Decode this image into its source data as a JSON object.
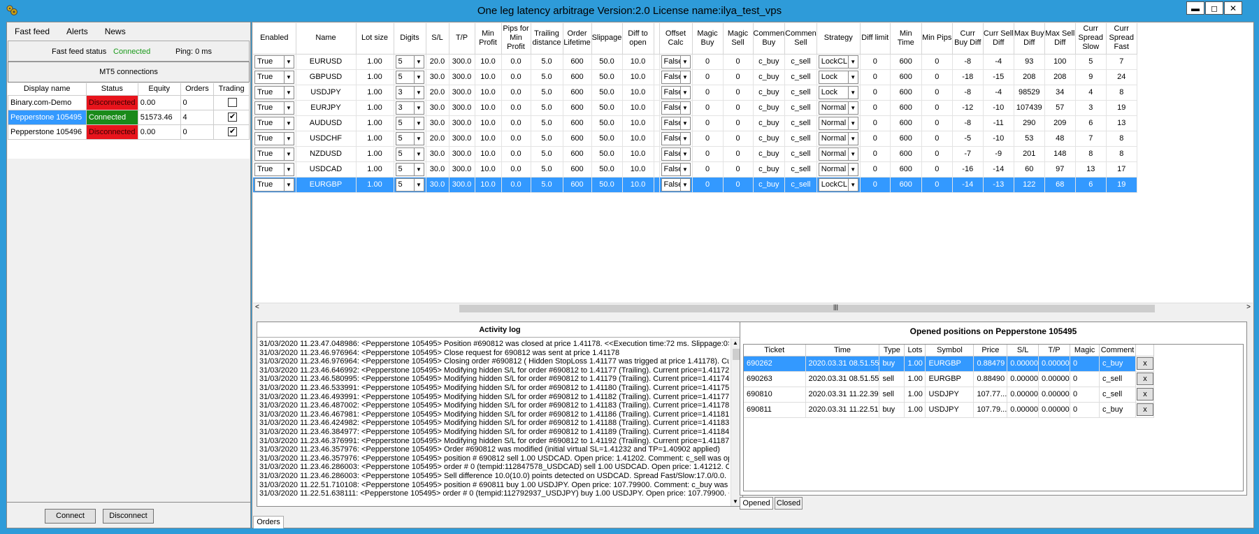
{
  "window": {
    "title": "One leg latency arbitrage Version:2.0 License name:ilya_test_vps",
    "minimize": "▬",
    "maximize": "◻",
    "close": "✕",
    "app_icon": "gear-cluster-icon"
  },
  "menu": {
    "items": [
      "Fast feed",
      "Alerts",
      "News"
    ]
  },
  "feed": {
    "status_label": "Fast feed status",
    "status_value": "Connected",
    "status_color": "#1a9a1a",
    "ping": "Ping: 0 ms"
  },
  "mt5_button": "MT5 connections",
  "accounts": {
    "headers": [
      "Display name",
      "Status",
      "Equity",
      "Orders",
      "Trading"
    ],
    "rows": [
      {
        "name": "Binary.com-Demo",
        "status": "Disconnected",
        "status_color": "#e8141c",
        "equity": "0.00",
        "orders": "0",
        "trading": false,
        "selected": false
      },
      {
        "name": "Pepperstone 105495",
        "status": "Connected",
        "status_color": "#1a8a1a",
        "equity": "51573.46",
        "orders": "4",
        "trading": true,
        "selected": true
      },
      {
        "name": "Pepperstone 105496",
        "status": "Disconnected",
        "status_color": "#e8141c",
        "equity": "0.00",
        "orders": "0",
        "trading": true,
        "selected": false
      }
    ]
  },
  "left_buttons": {
    "connect": "Connect",
    "disconnect": "Disconnect"
  },
  "grid": {
    "headers": [
      "Enabled",
      "Name",
      "Lot size",
      "Digits",
      "S/L",
      "T/P",
      "Min Profit",
      "Pips for Min Profit",
      "Trailing distance",
      "Order Lifetime",
      "Slippage",
      "Diff to open",
      "",
      "Offset Calc",
      "Magic Buy",
      "Magic Sell",
      "Commen Buy",
      "Commen Sell",
      "Strategy",
      "Diff limit",
      "Min Time",
      "Min Pips",
      "Curr Buy Diff",
      "Curr Sell Diff",
      "Max Buy Diff",
      "Max Sell Diff",
      "Curr Spread Slow",
      "Curr Spread Fast"
    ],
    "rows": [
      {
        "enabled": "True",
        "name": "EURUSD",
        "lot": "1.00",
        "digits": "5",
        "sl": "20.0",
        "tp": "300.0",
        "minp": "10.0",
        "pips": "0.0",
        "trail": "5.0",
        "life": "600",
        "slip": "50.0",
        "diff": "10.0",
        "offset": "False",
        "mbuy": "0",
        "msell": "0",
        "cbuy": "c_buy",
        "csell": "c_sell",
        "strategy": "LockCL",
        "dlimit": "0",
        "mintime": "600",
        "minpips": "0",
        "cbd": "-8",
        "csd": "-4",
        "mbd": "93",
        "msd": "100",
        "css": "5",
        "csf": "7",
        "selected": false
      },
      {
        "enabled": "True",
        "name": "GBPUSD",
        "lot": "1.00",
        "digits": "5",
        "sl": "30.0",
        "tp": "300.0",
        "minp": "10.0",
        "pips": "0.0",
        "trail": "5.0",
        "life": "600",
        "slip": "50.0",
        "diff": "10.0",
        "offset": "False",
        "mbuy": "0",
        "msell": "0",
        "cbuy": "c_buy",
        "csell": "c_sell",
        "strategy": "Lock",
        "dlimit": "0",
        "mintime": "600",
        "minpips": "0",
        "cbd": "-18",
        "csd": "-15",
        "mbd": "208",
        "msd": "208",
        "css": "9",
        "csf": "24",
        "selected": false
      },
      {
        "enabled": "True",
        "name": "USDJPY",
        "lot": "1.00",
        "digits": "3",
        "sl": "20.0",
        "tp": "300.0",
        "minp": "10.0",
        "pips": "0.0",
        "trail": "5.0",
        "life": "600",
        "slip": "50.0",
        "diff": "10.0",
        "offset": "False",
        "mbuy": "0",
        "msell": "0",
        "cbuy": "c_buy",
        "csell": "c_sell",
        "strategy": "Lock",
        "dlimit": "0",
        "mintime": "600",
        "minpips": "0",
        "cbd": "-8",
        "csd": "-4",
        "mbd": "98529",
        "msd": "34",
        "css": "4",
        "csf": "8",
        "selected": false
      },
      {
        "enabled": "True",
        "name": "EURJPY",
        "lot": "1.00",
        "digits": "3",
        "sl": "30.0",
        "tp": "300.0",
        "minp": "10.0",
        "pips": "0.0",
        "trail": "5.0",
        "life": "600",
        "slip": "50.0",
        "diff": "10.0",
        "offset": "False",
        "mbuy": "0",
        "msell": "0",
        "cbuy": "c_buy",
        "csell": "c_sell",
        "strategy": "Normal",
        "dlimit": "0",
        "mintime": "600",
        "minpips": "0",
        "cbd": "-12",
        "csd": "-10",
        "mbd": "107439",
        "msd": "57",
        "css": "3",
        "csf": "19",
        "selected": false
      },
      {
        "enabled": "True",
        "name": "AUDUSD",
        "lot": "1.00",
        "digits": "5",
        "sl": "30.0",
        "tp": "300.0",
        "minp": "10.0",
        "pips": "0.0",
        "trail": "5.0",
        "life": "600",
        "slip": "50.0",
        "diff": "10.0",
        "offset": "False",
        "mbuy": "0",
        "msell": "0",
        "cbuy": "c_buy",
        "csell": "c_sell",
        "strategy": "Normal",
        "dlimit": "0",
        "mintime": "600",
        "minpips": "0",
        "cbd": "-8",
        "csd": "-11",
        "mbd": "290",
        "msd": "209",
        "css": "6",
        "csf": "13",
        "selected": false
      },
      {
        "enabled": "True",
        "name": "USDCHF",
        "lot": "1.00",
        "digits": "5",
        "sl": "20.0",
        "tp": "300.0",
        "minp": "10.0",
        "pips": "0.0",
        "trail": "5.0",
        "life": "600",
        "slip": "50.0",
        "diff": "10.0",
        "offset": "False",
        "mbuy": "0",
        "msell": "0",
        "cbuy": "c_buy",
        "csell": "c_sell",
        "strategy": "Normal",
        "dlimit": "0",
        "mintime": "600",
        "minpips": "0",
        "cbd": "-5",
        "csd": "-10",
        "mbd": "53",
        "msd": "48",
        "css": "7",
        "csf": "8",
        "selected": false
      },
      {
        "enabled": "True",
        "name": "NZDUSD",
        "lot": "1.00",
        "digits": "5",
        "sl": "30.0",
        "tp": "300.0",
        "minp": "10.0",
        "pips": "0.0",
        "trail": "5.0",
        "life": "600",
        "slip": "50.0",
        "diff": "10.0",
        "offset": "False",
        "mbuy": "0",
        "msell": "0",
        "cbuy": "c_buy",
        "csell": "c_sell",
        "strategy": "Normal",
        "dlimit": "0",
        "mintime": "600",
        "minpips": "0",
        "cbd": "-7",
        "csd": "-9",
        "mbd": "201",
        "msd": "148",
        "css": "8",
        "csf": "8",
        "selected": false
      },
      {
        "enabled": "True",
        "name": "USDCAD",
        "lot": "1.00",
        "digits": "5",
        "sl": "30.0",
        "tp": "300.0",
        "minp": "10.0",
        "pips": "0.0",
        "trail": "5.0",
        "life": "600",
        "slip": "50.0",
        "diff": "10.0",
        "offset": "False",
        "mbuy": "0",
        "msell": "0",
        "cbuy": "c_buy",
        "csell": "c_sell",
        "strategy": "Normal",
        "dlimit": "0",
        "mintime": "600",
        "minpips": "0",
        "cbd": "-16",
        "csd": "-14",
        "mbd": "60",
        "msd": "97",
        "css": "13",
        "csf": "17",
        "selected": false
      },
      {
        "enabled": "True",
        "name": "EURGBP",
        "lot": "1.00",
        "digits": "5",
        "sl": "30.0",
        "tp": "300.0",
        "minp": "10.0",
        "pips": "0.0",
        "trail": "5.0",
        "life": "600",
        "slip": "50.0",
        "diff": "10.0",
        "offset": "False",
        "mbuy": "0",
        "msell": "0",
        "cbuy": "c_buy",
        "csell": "c_sell",
        "strategy": "LockCL",
        "dlimit": "0",
        "mintime": "600",
        "minpips": "0",
        "cbd": "-14",
        "csd": "-13",
        "mbd": "122",
        "msd": "68",
        "css": "6",
        "csf": "19",
        "selected": true
      }
    ],
    "scroll_grip": "|||",
    "scroll_left": "<",
    "scroll_right": ">"
  },
  "log": {
    "title": "Activity log",
    "lines": [
      "31/03/2020 11.23.47.048986: <Pepperstone 105495> Position #690812 was closed at price 1.41178. <<Execution time:72 ms. Slippage:0>",
      "31/03/2020 11.23.46.976964: <Pepperstone 105495> Close request for 690812 was sent at price 1.41178",
      "31/03/2020 11.23.46.976964: <Pepperstone 105495> Closing order #690812 ( Hidden StopLoss 1.41177 was trigged at price 1.41178). Cu",
      "31/03/2020 11.23.46.646992: <Pepperstone 105495> Modifying hidden S/L for order #690812 to 1.41177 (Trailing). Current price=1.41172",
      "31/03/2020 11.23.46.580995: <Pepperstone 105495> Modifying hidden S/L for order #690812 to 1.41179 (Trailing). Current price=1.41174",
      "31/03/2020 11.23.46.533991: <Pepperstone 105495> Modifying hidden S/L for order #690812 to 1.41180 (Trailing). Current price=1.41175",
      "31/03/2020 11.23.46.493991: <Pepperstone 105495> Modifying hidden S/L for order #690812 to 1.41182 (Trailing). Current price=1.41177",
      "31/03/2020 11.23.46.487002: <Pepperstone 105495> Modifying hidden S/L for order #690812 to 1.41183 (Trailing). Current price=1.41178",
      "31/03/2020 11.23.46.467981: <Pepperstone 105495> Modifying hidden S/L for order #690812 to 1.41186 (Trailing). Current price=1.41181",
      "31/03/2020 11.23.46.424982: <Pepperstone 105495> Modifying hidden S/L for order #690812 to 1.41188 (Trailing). Current price=1.41183",
      "31/03/2020 11.23.46.384977: <Pepperstone 105495> Modifying hidden S/L for order #690812 to 1.41189 (Trailing). Current price=1.41184",
      "31/03/2020 11.23.46.376991: <Pepperstone 105495> Modifying hidden S/L for order #690812 to 1.41192 (Trailing). Current price=1.41187",
      "31/03/2020 11.23.46.357976: <Pepperstone 105495> Order #690812 was modified (initial virtual SL=1.41232 and TP=1.40902 applied)",
      "31/03/2020 11.23.46.357976: <Pepperstone 105495> position # 690812 sell 1.00 USDCAD. Open price: 1.41202. Comment: c_sell was ope",
      "31/03/2020 11.23.46.286003: <Pepperstone 105495> order # 0 (tempid:112847578_USDCAD) sell 1.00 USDCAD. Open price: 1.41212. Co",
      "31/03/2020 11.23.46.286003: <Pepperstone 105495> Sell difference 10.0(10.0) points detected on USDCAD. Spread Fast/Slow:17.0/0.0. I",
      "31/03/2020 11.22.51.710108: <Pepperstone 105495> position # 690811 buy 1.00 USDJPY. Open price: 107.79900. Comment: c_buy was",
      "31/03/2020 11.22.51.638111: <Pepperstone 105495> order # 0 (tempid:112792937_USDJPY) buy 1.00 USDJPY. Open price: 107.79900. C"
    ]
  },
  "positions": {
    "title": "Opened positions on Pepperstone 105495",
    "headers": [
      "Ticket",
      "Time",
      "Type",
      "Lots",
      "Symbol",
      "Price",
      "S/L",
      "T/P",
      "Magic",
      "Comment"
    ],
    "rows": [
      {
        "ticket": "690262",
        "time": "2020.03.31 08.51.55",
        "type": "buy",
        "lots": "1.00",
        "symbol": "EURGBP",
        "price": "0.88479",
        "sl": "0.00000",
        "tp": "0.00000",
        "magic": "0",
        "comment": "c_buy",
        "selected": true
      },
      {
        "ticket": "690263",
        "time": "2020.03.31 08.51.55",
        "type": "sell",
        "lots": "1.00",
        "symbol": "EURGBP",
        "price": "0.88490",
        "sl": "0.00000",
        "tp": "0.00000",
        "magic": "0",
        "comment": "c_sell",
        "selected": false
      },
      {
        "ticket": "690810",
        "time": "2020.03.31 11.22.39",
        "type": "sell",
        "lots": "1.00",
        "symbol": "USDJPY",
        "price": "107.77...",
        "sl": "0.00000",
        "tp": "0.00000",
        "magic": "0",
        "comment": "c_sell",
        "selected": false
      },
      {
        "ticket": "690811",
        "time": "2020.03.31 11.22.51",
        "type": "buy",
        "lots": "1.00",
        "symbol": "USDJPY",
        "price": "107.79...",
        "sl": "0.00000",
        "tp": "0.00000",
        "magic": "0",
        "comment": "c_buy",
        "selected": false
      }
    ],
    "close_label": "x",
    "tabs": [
      "Opened",
      "Closed"
    ]
  },
  "bottom_tab": "Orders",
  "colors": {
    "accent": "#2e9bd9",
    "selection": "#3399ff",
    "disconnected": "#e8141c",
    "connected": "#1a8a1a"
  }
}
